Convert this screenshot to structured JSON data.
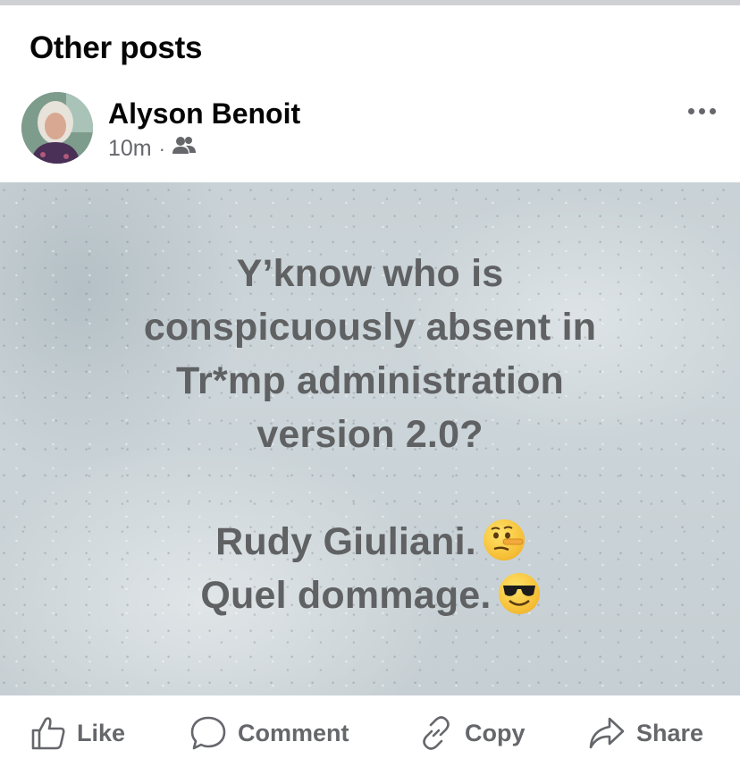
{
  "section": {
    "title": "Other posts"
  },
  "post": {
    "author": "Alyson Benoit",
    "time": "10m",
    "separator": "·",
    "audience_icon": "friends-icon",
    "more_icon": "more-options-icon",
    "image_text": {
      "lines": [
        "Y’know who is",
        "conspicuously absent in",
        "Tr*mp administration",
        "version 2.0?",
        "",
        "Rudy Giuliani.",
        "Quel dommage."
      ],
      "emoji_1": "lying-face-emoji",
      "emoji_2": "sunglasses-face-emoji"
    }
  },
  "actions": {
    "like": "Like",
    "comment": "Comment",
    "copy": "Copy",
    "share": "Share"
  },
  "colors": {
    "divider": "#ced0d4",
    "secondary_text": "#65676b",
    "image_text": "#5f6163"
  }
}
